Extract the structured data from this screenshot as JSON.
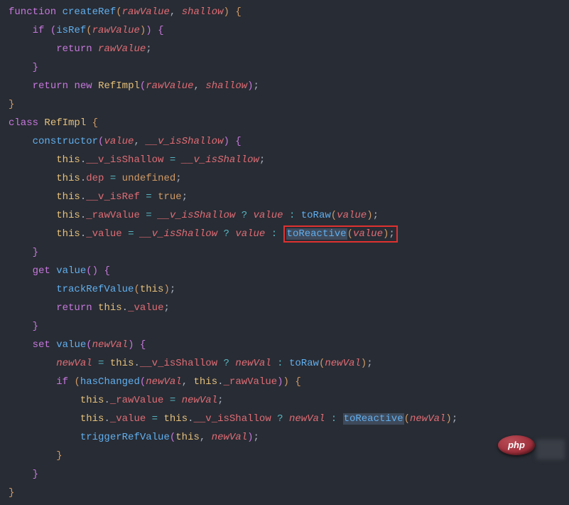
{
  "badge": "php",
  "t": {
    "function": "function",
    "createRef": "createRef",
    "rawValue": "rawValue",
    "shallow": "shallow",
    "if": "if",
    "isRef": "isRef",
    "return": "return",
    "new": "new",
    "RefImpl": "RefImpl",
    "class": "class",
    "constructor": "constructor",
    "value": "value",
    "v_isShallow": "__v_isShallow",
    "this": "this",
    "_v_isShallow": "__v_isShallow",
    "dep": "dep",
    "undefined": "undefined",
    "_v_isRef": "__v_isRef",
    "true": "true",
    "_rawValue": "_rawValue",
    "toRaw": "toRaw",
    "_value": "_value",
    "toReactive": "toReactive",
    "get": "get",
    "trackRefValue": "trackRefValue",
    "set": "set",
    "newVal": "newVal",
    "hasChanged": "hasChanged",
    "triggerRefValue": "triggerRefValue"
  }
}
